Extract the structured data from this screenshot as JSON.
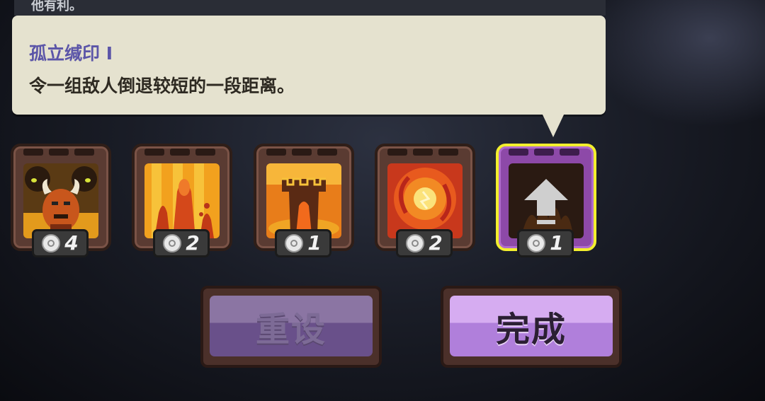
{
  "top_text": "他有利。",
  "tooltip": {
    "title": "孤立缄印 I",
    "description": "令一组敌人倒退较短的一段距离。"
  },
  "upgrades": [
    {
      "name": "demon-portrait-icon",
      "cost": "4",
      "selected": false
    },
    {
      "name": "lava-spires-icon",
      "cost": "2",
      "selected": false
    },
    {
      "name": "fire-tower-icon",
      "cost": "1",
      "selected": false
    },
    {
      "name": "fire-orb-icon",
      "cost": "2",
      "selected": false
    },
    {
      "name": "upgrade-arrow-icon",
      "cost": "1",
      "selected": true
    }
  ],
  "buttons": {
    "reset": "重设",
    "done": "完成"
  },
  "colors": {
    "tooltip_bg": "#e5e2cf",
    "title": "#5b55a8",
    "selected_frame": "#8d49a8",
    "selected_border": "#f3ef2d",
    "done_button": "#d6acf1",
    "reset_button_disabled": "#8b75a3"
  }
}
